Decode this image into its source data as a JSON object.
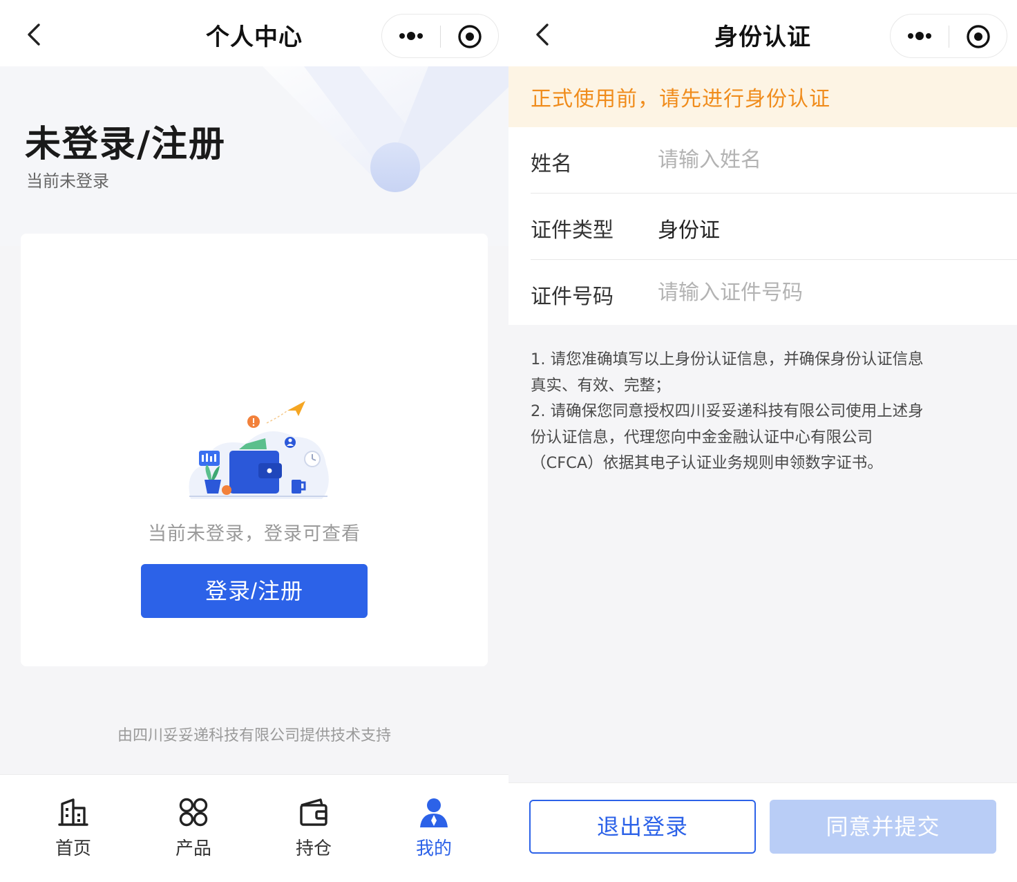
{
  "left": {
    "nav": {
      "title": "个人中心"
    },
    "hero": {
      "title": "未登录/注册",
      "subtitle": "当前未登录"
    },
    "card": {
      "hint": "当前未登录，登录可查看",
      "login_button": "登录/注册"
    },
    "footer_note": "由四川妥妥递科技有限公司提供技术支持",
    "tabbar": {
      "items": [
        {
          "label": "首页",
          "icon": "building-icon"
        },
        {
          "label": "产品",
          "icon": "grid-icon"
        },
        {
          "label": "持仓",
          "icon": "wallet-icon"
        },
        {
          "label": "我的",
          "icon": "person-icon",
          "active": true
        }
      ]
    }
  },
  "right": {
    "nav": {
      "title": "身份认证"
    },
    "notice": "正式使用前，请先进行身份认证",
    "form": {
      "name_label": "姓名",
      "name_placeholder": "请输入姓名",
      "id_type_label": "证件类型",
      "id_type_value": "身份证",
      "id_number_label": "证件号码",
      "id_number_placeholder": "请输入证件号码"
    },
    "terms": {
      "line1": "1. 请您准确填写以上身份认证信息，并确保身份认证信息",
      "line2": "真实、有效、完整；",
      "line3": "2. 请确保您同意授权四川妥妥递科技有限公司使用上述身",
      "line4": "份认证信息，代理您向中金金融认证中心有限公司",
      "line5": "（CFCA）依据其电子认证业务规则申领数字证书。"
    },
    "buttons": {
      "logout": "退出登录",
      "submit": "同意并提交"
    }
  },
  "colors": {
    "primary": "#2c62e8",
    "primary_disabled": "#b9cdf6",
    "notice_bg": "#fdf4e4",
    "notice_text": "#f08c1c",
    "page_bg": "#f5f5f7"
  }
}
